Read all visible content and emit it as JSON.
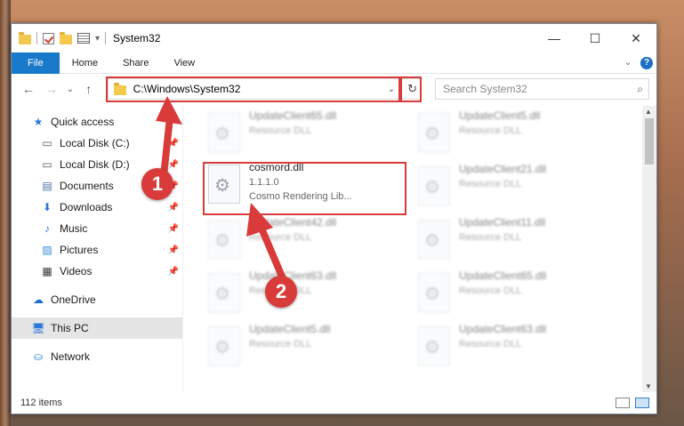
{
  "window": {
    "title": "System32",
    "minimize_glyph": "—",
    "maximize_glyph": "☐",
    "close_glyph": "✕"
  },
  "ribbon": {
    "tabs": [
      "File",
      "Home",
      "Share",
      "View"
    ],
    "help_label": "?"
  },
  "address": {
    "path": "C:\\Windows\\System32",
    "back_glyph": "←",
    "forward_glyph": "→",
    "recent_glyph": "⌄",
    "up_glyph": "↑",
    "refresh_glyph": "↻",
    "dropdown_glyph": "⌄"
  },
  "search": {
    "placeholder": "Search System32",
    "icon": "search-icon"
  },
  "sidebar": {
    "items": [
      {
        "label": "Quick access",
        "icon": "star-icon",
        "glyph": "★",
        "color": "#2e7bd6",
        "pinned": false
      },
      {
        "label": "Local Disk (C:)",
        "icon": "drive-icon",
        "glyph": "▭",
        "color": "#555555",
        "pinned": true
      },
      {
        "label": "Local Disk (D:)",
        "icon": "drive-icon",
        "glyph": "▭",
        "color": "#555555",
        "pinned": true
      },
      {
        "label": "Documents",
        "icon": "documents-icon",
        "glyph": "▤",
        "color": "#4a6fa5",
        "pinned": true
      },
      {
        "label": "Downloads",
        "icon": "download-icon",
        "glyph": "⬇",
        "color": "#2a78d6",
        "pinned": true
      },
      {
        "label": "Music",
        "icon": "music-icon",
        "glyph": "♪",
        "color": "#2a78d6",
        "pinned": true
      },
      {
        "label": "Pictures",
        "icon": "pictures-icon",
        "glyph": "▨",
        "color": "#3a8ad6",
        "pinned": true
      },
      {
        "label": "Videos",
        "icon": "videos-icon",
        "glyph": "▦",
        "color": "#333333",
        "pinned": true
      },
      {
        "label": "OneDrive",
        "icon": "cloud-icon",
        "glyph": "☁",
        "color": "#1a6fd0",
        "pinned": false
      },
      {
        "label": "This PC",
        "icon": "computer-icon",
        "glyph": "🖥",
        "color": "#2a78d6",
        "pinned": false
      },
      {
        "label": "Network",
        "icon": "network-icon",
        "glyph": "⛀",
        "color": "#2a78d6",
        "pinned": false
      }
    ],
    "pin_glyph": "📌"
  },
  "files": {
    "highlighted": {
      "name": "cosmord.dll",
      "version": "1.1.1.0",
      "description": "Cosmo Rendering Lib..."
    },
    "left_column": [
      {
        "name": "UpdateClient65.dll",
        "type": "Resource DLL"
      },
      {
        "name": "UpdateClient42.dll",
        "type": "Resource DLL"
      },
      {
        "name": "UpdateClient63.dll",
        "type": "Resource DLL"
      },
      {
        "name": "UpdateClient5.dll",
        "type": "Resource DLL"
      }
    ],
    "right_column": [
      {
        "name": "UpdateClient5.dll",
        "type": "Resource DLL"
      },
      {
        "name": "UpdateClient21.dll",
        "type": "Resource DLL"
      },
      {
        "name": "UpdateClient11.dll",
        "type": "Resource DLL"
      },
      {
        "name": "UpdateClient65.dll",
        "type": "Resource DLL"
      },
      {
        "name": "UpdateClient63.dll",
        "type": "Resource DLL"
      }
    ]
  },
  "status": {
    "item_count": "112 items"
  },
  "annotations": {
    "marker_1": "1",
    "marker_2": "2",
    "color": "#d93a3a"
  }
}
